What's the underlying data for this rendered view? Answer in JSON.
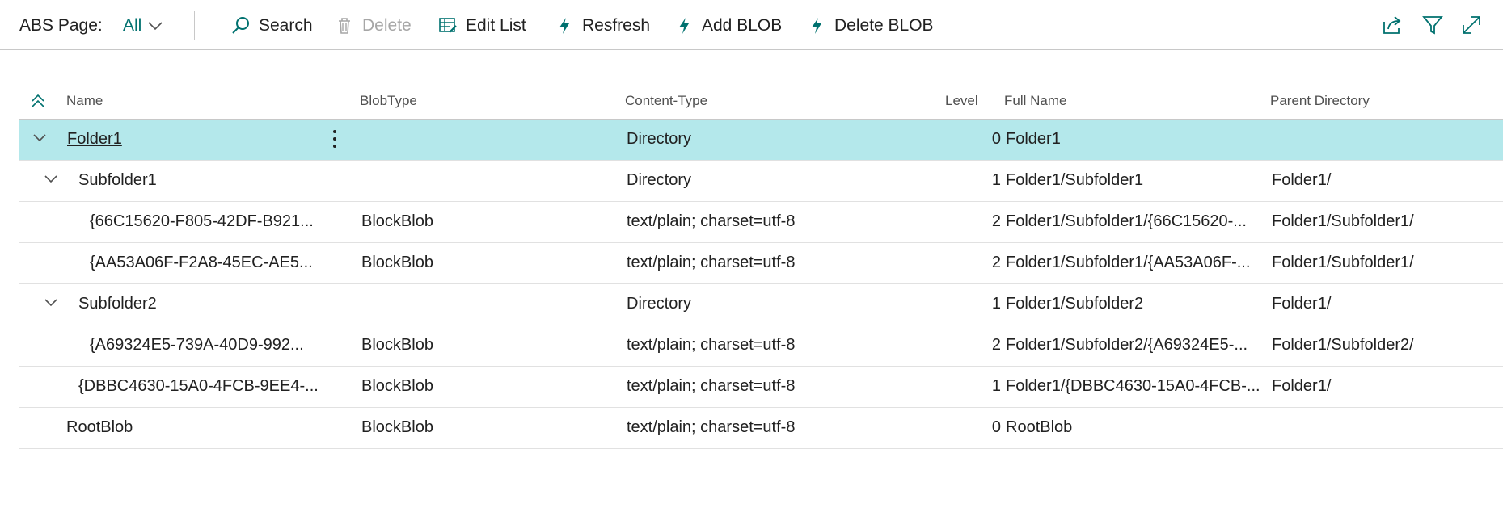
{
  "page": {
    "label": "ABS Page:",
    "view": "All"
  },
  "actions": {
    "search": "Search",
    "delete": "Delete",
    "edit_list": "Edit List",
    "refresh": "Resfresh",
    "add_blob": "Add BLOB",
    "delete_blob": "Delete BLOB"
  },
  "columns": {
    "name": "Name",
    "blobtype": "BlobType",
    "content_type": "Content-Type",
    "level": "Level",
    "full_name": "Full Name",
    "parent_directory": "Parent Directory"
  },
  "rows": [
    {
      "name": "Folder1",
      "blobtype": "",
      "content_type": "Directory",
      "level": "0",
      "full_name": "Folder1",
      "parent": ""
    },
    {
      "name": "Subfolder1",
      "blobtype": "",
      "content_type": "Directory",
      "level": "1",
      "full_name": "Folder1/Subfolder1",
      "parent": "Folder1/"
    },
    {
      "name": "{66C15620-F805-42DF-B921...",
      "blobtype": "BlockBlob",
      "content_type": "text/plain; charset=utf-8",
      "level": "2",
      "full_name": "Folder1/Subfolder1/{66C15620-...",
      "parent": "Folder1/Subfolder1/"
    },
    {
      "name": "{AA53A06F-F2A8-45EC-AE5...",
      "blobtype": "BlockBlob",
      "content_type": "text/plain; charset=utf-8",
      "level": "2",
      "full_name": "Folder1/Subfolder1/{AA53A06F-...",
      "parent": "Folder1/Subfolder1/"
    },
    {
      "name": "Subfolder2",
      "blobtype": "",
      "content_type": "Directory",
      "level": "1",
      "full_name": "Folder1/Subfolder2",
      "parent": "Folder1/"
    },
    {
      "name": "{A69324E5-739A-40D9-992...",
      "blobtype": "BlockBlob",
      "content_type": "text/plain; charset=utf-8",
      "level": "2",
      "full_name": "Folder1/Subfolder2/{A69324E5-...",
      "parent": "Folder1/Subfolder2/"
    },
    {
      "name": "{DBBC4630-15A0-4FCB-9EE4-...",
      "blobtype": "BlockBlob",
      "content_type": "text/plain; charset=utf-8",
      "level": "1",
      "full_name": "Folder1/{DBBC4630-15A0-4FCB-...",
      "parent": "Folder1/"
    },
    {
      "name": "RootBlob",
      "blobtype": "BlockBlob",
      "content_type": "text/plain; charset=utf-8",
      "level": "0",
      "full_name": "RootBlob",
      "parent": ""
    }
  ],
  "colors": {
    "accent": "#00716f",
    "selected_row": "#b4e8eb"
  }
}
